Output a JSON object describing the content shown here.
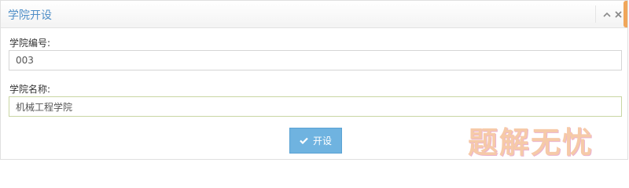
{
  "panel": {
    "title": "学院开设",
    "collapse_icon": "chevron-up-icon",
    "close_icon": "close-icon"
  },
  "form": {
    "id_label": "学院编号:",
    "id_value": "003",
    "name_label": "学院名称:",
    "name_value": "机械工程学院",
    "submit_label": "开设",
    "submit_icon": "check-icon"
  },
  "watermark": {
    "text": "题解无忧"
  },
  "colors": {
    "title": "#4f8ec7",
    "button": "#6fb3e0",
    "accent_tab": "#f0a65a"
  }
}
